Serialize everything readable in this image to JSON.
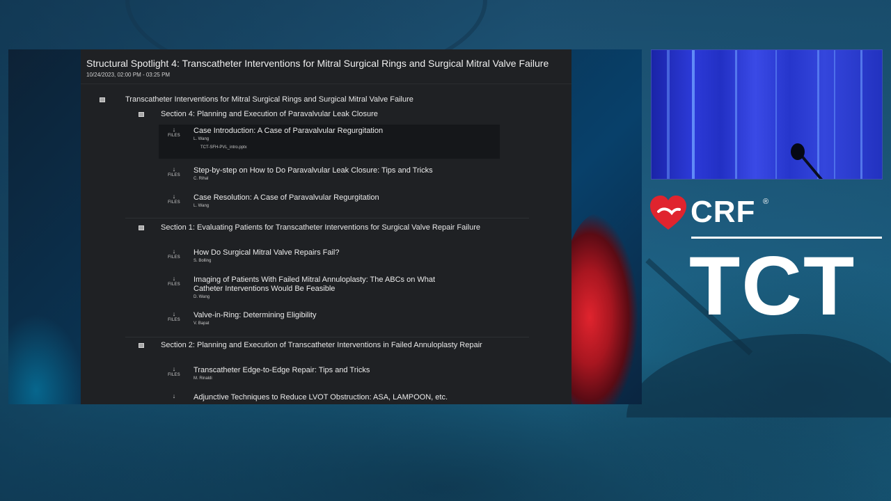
{
  "session": {
    "title": "Structural Spotlight 4: Transcatheter Interventions for Mitral Surgical Rings and Surgical Mitral Valve Failure",
    "datetime": "10/24/2023, 02:00 PM - 03:25 PM"
  },
  "tree": {
    "root_label": "Transcatheter Interventions for Mitral Surgical Rings and Surgical Mitral Valve Failure",
    "files_label": "FILES",
    "sections": [
      {
        "label": "Section 4: Planning and Execution of Paravalvular Leak Closure",
        "talks": [
          {
            "title": "Case Introduction: A Case of Paravalvular Regurgitation",
            "author": "L. Wang",
            "file": "TCT-SFH-PVL_intro.pptx"
          },
          {
            "title": "Step-by-step on How to Do Paravalvular Leak Closure: Tips and Tricks",
            "author": "C. Rihal"
          },
          {
            "title": "Case Resolution: A Case of Paravalvular Regurgitation",
            "author": "L. Wang"
          }
        ]
      },
      {
        "label": "Section 1: Evaluating Patients for Transcatheter Interventions for Surgical Valve Repair Failure",
        "talks": [
          {
            "title": "How Do Surgical Mitral Valve Repairs Fail?",
            "author": "S. Bolling"
          },
          {
            "title": "Imaging of Patients With Failed Mitral Annuloplasty: The ABCs on What Catheter Interventions Would Be Feasible",
            "author": "D. Wang"
          },
          {
            "title": "Valve-in-Ring: Determining Eligibility",
            "author": "V. Bapat"
          }
        ]
      },
      {
        "label": "Section 2: Planning and Execution of Transcatheter Interventions in Failed Annuloplasty Repair",
        "talks": [
          {
            "title": "Transcatheter Edge-to-Edge Repair: Tips and Tricks",
            "author": "M. Rinaldi"
          },
          {
            "title": "Adjunctive Techniques to Reduce LVOT Obstruction: ASA, LAMPOON, etc."
          }
        ]
      }
    ]
  },
  "logo": {
    "brand": "CRF",
    "registered": "®",
    "event": "TCT"
  },
  "colors": {
    "panel_bg": "#1f2124",
    "highlight_row": "#15171a",
    "heart_red": "#e0242e",
    "logo_white": "#ffffff"
  },
  "icons": {
    "download": "download-arrow-icon",
    "expand": "tree-toggle-icon",
    "logo": "crf-heart-icon"
  }
}
